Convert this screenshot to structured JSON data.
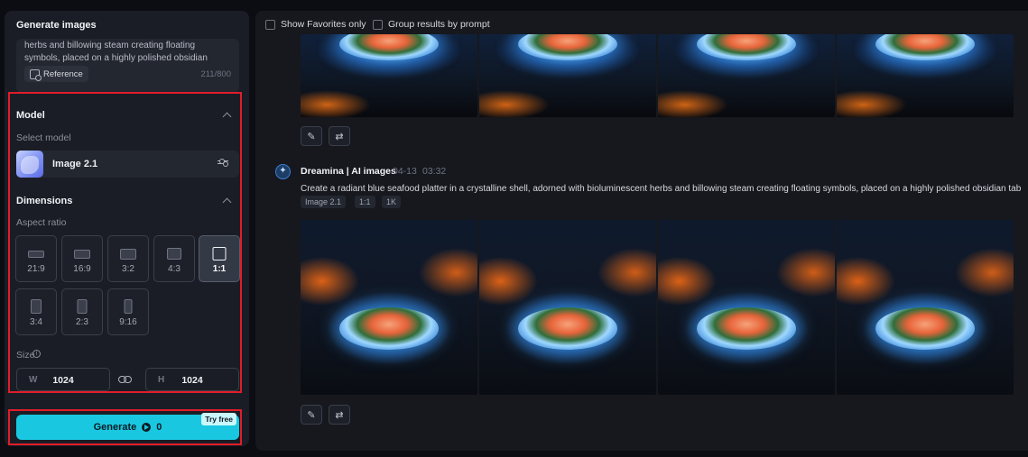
{
  "left_panel": {
    "title": "Generate images",
    "prompt_text": "herbs and billowing steam creating floating symbols, placed on a highly polished obsidian",
    "reference_label": "Reference",
    "char_count": "211/800",
    "model_section": {
      "title": "Model",
      "select_label": "Select model",
      "model_name": "Image 2.1"
    },
    "dimensions_section": {
      "title": "Dimensions",
      "aspect_label": "Aspect ratio",
      "ratios": [
        "21:9",
        "16:9",
        "3:2",
        "4:3",
        "1:1",
        "3:4",
        "2:3",
        "9:16"
      ],
      "selected_ratio": "1:1",
      "size_label": "Size",
      "width_prefix": "W",
      "width_value": "1024",
      "height_prefix": "H",
      "height_value": "1024"
    },
    "generate": {
      "label": "Generate",
      "cost": "0",
      "badge": "Try free"
    }
  },
  "right_panel": {
    "filters": {
      "show_favorites": "Show Favorites only",
      "group_by_prompt": "Group results by prompt"
    },
    "result": {
      "author": "Dreamina | AI images",
      "date": "04-13",
      "time": "03:32",
      "prompt": "Create a radiant blue seafood platter in a crystalline shell, adorned with bioluminescent herbs and billowing steam creating floating symbols, placed on a highly polished obsidian tab",
      "tags": [
        "Image 2.1",
        "1:1",
        "1K"
      ]
    },
    "actions": {
      "edit_icon": "pencil-icon",
      "regenerate_icon": "repeat-icon"
    }
  },
  "colors": {
    "accent": "#19c8e0",
    "highlight_outline": "#e11d2a",
    "panel_bg": "#1a1d25",
    "page_bg": "#0b0d12"
  }
}
